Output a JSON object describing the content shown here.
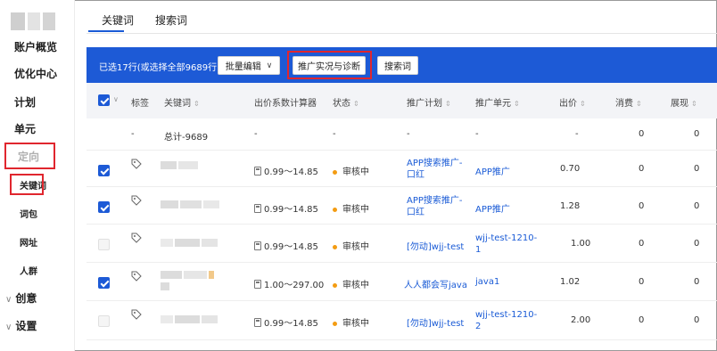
{
  "sidebar": {
    "items": [
      {
        "label": "账户概览"
      },
      {
        "label": "优化中心"
      },
      {
        "label": "计划"
      },
      {
        "label": "单元"
      },
      {
        "label": "定向"
      },
      {
        "label": "关键词"
      },
      {
        "label": "词包"
      },
      {
        "label": "网址"
      },
      {
        "label": "人群"
      },
      {
        "label": "创意"
      },
      {
        "label": "设置"
      }
    ]
  },
  "tabs": [
    {
      "label": "关键词"
    },
    {
      "label": "搜索词"
    }
  ],
  "toolbar": {
    "selection_info": "已选17行(或选择全部9689行)",
    "batch_edit": "批量编辑",
    "promo_diagnose": "推广实况与诊断",
    "search_terms": "搜索词"
  },
  "table": {
    "headers": {
      "tag": "标签",
      "keyword": "关键词",
      "bid_calc": "出价系数计算器",
      "status": "状态",
      "plan": "推广计划",
      "unit": "推广单元",
      "bid": "出价",
      "cost": "消费",
      "impressions": "展现"
    },
    "sort_glyph": "⇕",
    "total_row": {
      "dash": "-",
      "keyword": "总计-9689",
      "cost": "0",
      "impressions": "0"
    },
    "rows": [
      {
        "checked": true,
        "calc": "0.99～14.85",
        "status": "审核中",
        "plan": [
          "APP搜索推广-",
          "口红"
        ],
        "unit": [
          "APP推广"
        ],
        "bid": "0.70",
        "cost": "0",
        "impressions": "0"
      },
      {
        "checked": true,
        "calc": "0.99～14.85",
        "status": "审核中",
        "plan": [
          "APP搜索推广-",
          "口红"
        ],
        "unit": [
          "APP推广"
        ],
        "bid": "1.28",
        "cost": "0",
        "impressions": "0"
      },
      {
        "checked": false,
        "calc": "0.99～14.85",
        "status": "审核中",
        "plan": [
          "[勿动]wjj-test"
        ],
        "unit": [
          "wjj-test-1210-",
          "1"
        ],
        "bid": "1.00",
        "cost": "0",
        "impressions": "0"
      },
      {
        "checked": true,
        "calc": "1.00～297.00",
        "status": "审核中",
        "plan": [
          "人人都会写java"
        ],
        "unit": [
          "java1"
        ],
        "bid": "1.02",
        "cost": "0",
        "impressions": "0"
      },
      {
        "checked": false,
        "calc": "0.99～14.85",
        "status": "审核中",
        "plan": [
          "[勿动]wjj-test"
        ],
        "unit": [
          "wjj-test-1210-",
          "2"
        ],
        "bid": "2.00",
        "cost": "0",
        "impressions": "0"
      }
    ]
  },
  "colors": {
    "accent": "#1d5ad6",
    "highlight_box": "#e0262e",
    "status_dot": "#f39c12"
  }
}
